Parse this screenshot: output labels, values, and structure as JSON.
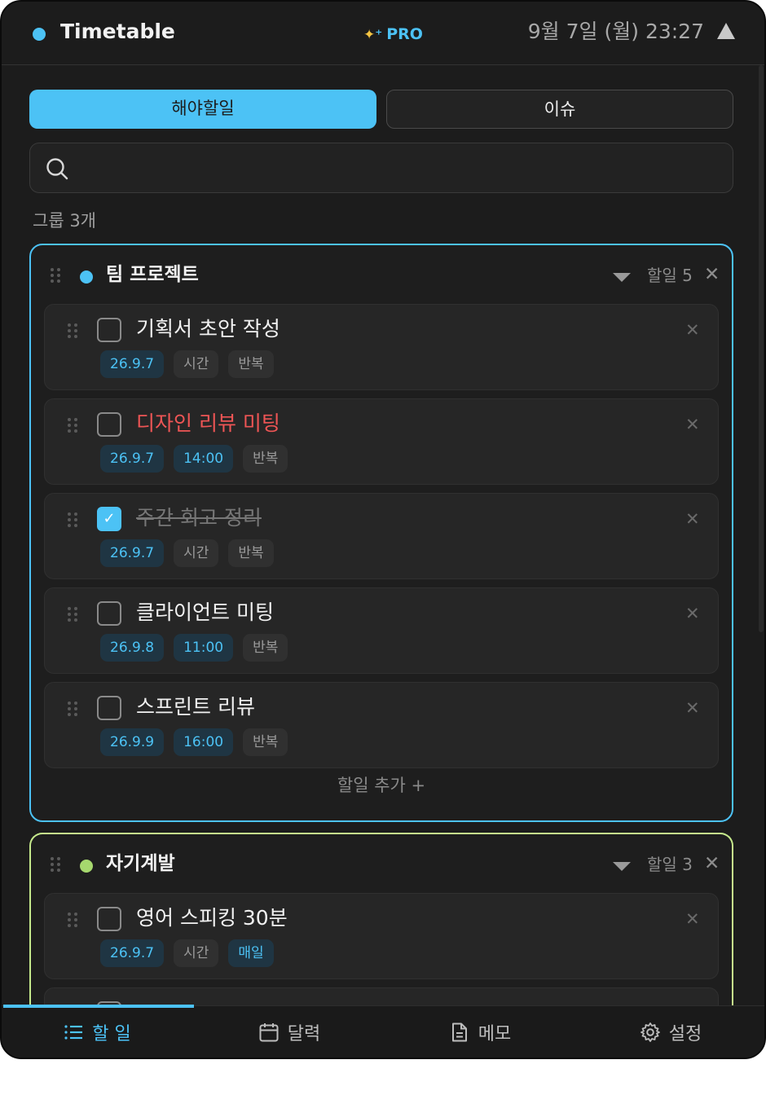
{
  "header": {
    "title": "Timetable",
    "pro_label": "PRO",
    "clock": "9월 7일 (월) 23:27",
    "accent": "#4cc2f5"
  },
  "tabs": [
    {
      "label": "해야할일",
      "active": true
    },
    {
      "label": "이슈",
      "active": false
    }
  ],
  "search": {
    "placeholder": ""
  },
  "group_count": "그룹 3개",
  "groups": [
    {
      "name": "팀 프로젝트",
      "color": "#4cc2f5",
      "count_label": "할일 5",
      "close": "✕",
      "add_task": "할일 추가 +",
      "tasks": [
        {
          "title": "기획서 초안 작성",
          "checked": false,
          "style": "normal",
          "chips": [
            "26.9.7",
            "시간",
            "반복"
          ]
        },
        {
          "title": "디자인 리뷰 미팅",
          "checked": false,
          "style": "red",
          "chips": [
            "26.9.7",
            "14:00",
            "반복"
          ]
        },
        {
          "title": "주간 회고 정리",
          "checked": true,
          "style": "done",
          "chips": [
            "26.9.7",
            "시간",
            "반복"
          ]
        },
        {
          "title": "클라이언트 미팅",
          "checked": false,
          "style": "normal",
          "chips": [
            "26.9.8",
            "11:00",
            "반복"
          ]
        },
        {
          "title": "스프린트 리뷰",
          "checked": false,
          "style": "normal",
          "chips": [
            "26.9.9",
            "16:00",
            "반복"
          ]
        }
      ]
    },
    {
      "name": "자기계발",
      "color": "#a6d86e",
      "count_label": "할일 3",
      "close": "✕",
      "tasks": [
        {
          "title": "영어 스피킹 30분",
          "checked": false,
          "style": "normal",
          "chips": [
            "26.9.7",
            "시간",
            "매일"
          ]
        }
      ]
    }
  ],
  "task_close": "✕",
  "check_mark": "✓",
  "nav": [
    {
      "label": "할 일",
      "icon": "list-icon",
      "active": true
    },
    {
      "label": "달력",
      "icon": "calendar-icon",
      "active": false
    },
    {
      "label": "메모",
      "icon": "document-icon",
      "active": false
    },
    {
      "label": "설정",
      "icon": "gear-icon",
      "active": false
    }
  ]
}
